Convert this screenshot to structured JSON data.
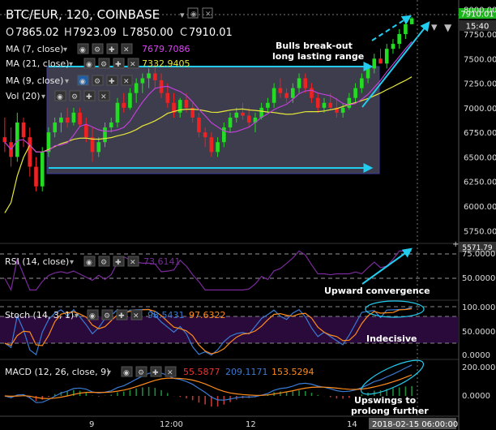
{
  "header": {
    "symbol": "BTC/EUR, 120, COINBASE",
    "ohlc": [
      {
        "k": "O",
        "v": "7865.02"
      },
      {
        "k": "H",
        "v": "7923.09"
      },
      {
        "k": "L",
        "v": "7850.00"
      },
      {
        "k": "C",
        "v": "7910.01"
      }
    ]
  },
  "indicators_main": [
    {
      "label": "MA (7, close)",
      "value": "7679.7086",
      "color": "#e040fb"
    },
    {
      "label": "MA (21, close)",
      "value": "7332.9405",
      "color": "#e8e83a"
    },
    {
      "label": "MA (9, close)",
      "value": "",
      "color": ""
    },
    {
      "label": "Vol (20)",
      "value": "",
      "color": ""
    }
  ],
  "price_badges": {
    "last": "7910.01",
    "time": "15:40"
  },
  "annotations": {
    "bulls": [
      "Bulls break-out",
      "long lasting range"
    ],
    "rsi": "Upward convergence",
    "stoch": "Indecisive",
    "macd": [
      "Upswings to",
      "prolong further"
    ]
  },
  "panes": {
    "rsi": {
      "label": "RSI (14, close)",
      "value": "73.6141",
      "ticks": [
        "75.0000",
        "50.0000"
      ]
    },
    "stoch": {
      "label": "Stoch (14, 3, 1)",
      "values": [
        "98.5431",
        "97.6322"
      ],
      "ticks": [
        "100.0000",
        "50.0000",
        "0.0000"
      ]
    },
    "macd": {
      "label": "MACD (12, 26, close, 9)",
      "values": [
        "55.5877",
        "209.1171",
        "153.5294"
      ],
      "ticks": [
        "200.0000",
        "0.0000"
      ]
    }
  },
  "x_axis": {
    "labels": [
      "9",
      "12:00",
      "12",
      "14"
    ],
    "current": "2018-02-15 06:00:00"
  },
  "colors": {
    "up": "#22dd22",
    "down": "#ee2222",
    "range_box": "#4a4a5e",
    "arrow": "#22ccee",
    "rsi": "#7a2a9a",
    "stoch_k": "#3a7bd5",
    "stoch_d": "#ff8c1a",
    "macd": "#3a7bd5",
    "signal": "#ff8c1a"
  },
  "chart_data": {
    "type": "candlestick",
    "y_ticks": [
      8000,
      7750,
      7500,
      7250,
      7000,
      6750,
      6500,
      6250,
      6000,
      5750
    ],
    "ylim": [
      5620,
      8080
    ],
    "candles": [
      [
        6700,
        6900,
        6550,
        6650
      ],
      [
        6650,
        6800,
        6400,
        6500
      ],
      [
        6500,
        6950,
        6450,
        6850
      ],
      [
        6850,
        6900,
        6600,
        6700
      ],
      [
        6700,
        6800,
        6300,
        6400
      ],
      [
        6400,
        6500,
        6150,
        6200
      ],
      [
        6200,
        6600,
        6150,
        6550
      ],
      [
        6550,
        6800,
        6500,
        6750
      ],
      [
        6750,
        6900,
        6700,
        6850
      ],
      [
        6850,
        6950,
        6750,
        6900
      ],
      [
        6900,
        7000,
        6800,
        6850
      ],
      [
        6850,
        7000,
        6820,
        6950
      ],
      [
        6950,
        7000,
        6800,
        6830
      ],
      [
        6830,
        6900,
        6650,
        6700
      ],
      [
        6700,
        6800,
        6450,
        6550
      ],
      [
        6550,
        6700,
        6500,
        6650
      ],
      [
        6650,
        6850,
        6600,
        6800
      ],
      [
        6800,
        6900,
        6750,
        6850
      ],
      [
        6850,
        7100,
        6800,
        7050
      ],
      [
        7050,
        7150,
        6950,
        7000
      ],
      [
        7000,
        7200,
        6980,
        7150
      ],
      [
        7150,
        7300,
        7050,
        7250
      ],
      [
        7250,
        7350,
        7150,
        7300
      ],
      [
        7300,
        7400,
        7200,
        7350
      ],
      [
        7350,
        7450,
        7200,
        7280
      ],
      [
        7280,
        7350,
        7100,
        7150
      ],
      [
        7150,
        7250,
        7000,
        7050
      ],
      [
        7050,
        7150,
        6900,
        6950
      ],
      [
        6950,
        7100,
        6900,
        7080
      ],
      [
        7080,
        7150,
        6950,
        7000
      ],
      [
        7000,
        7050,
        6850,
        6900
      ],
      [
        6900,
        6950,
        6700,
        6750
      ],
      [
        6750,
        6800,
        6600,
        6700
      ],
      [
        6700,
        6750,
        6500,
        6550
      ],
      [
        6550,
        6700,
        6500,
        6650
      ],
      [
        6650,
        6850,
        6600,
        6800
      ],
      [
        6800,
        6950,
        6750,
        6900
      ],
      [
        6900,
        7000,
        6850,
        6950
      ],
      [
        6950,
        7050,
        6880,
        6920
      ],
      [
        6920,
        7000,
        6800,
        6850
      ],
      [
        6850,
        6950,
        6750,
        6900
      ],
      [
        6900,
        7050,
        6880,
        7000
      ],
      [
        7000,
        7100,
        6950,
        7050
      ],
      [
        7050,
        7250,
        7000,
        7200
      ],
      [
        7200,
        7300,
        7100,
        7150
      ],
      [
        7150,
        7200,
        7050,
        7100
      ],
      [
        7100,
        7250,
        7050,
        7200
      ],
      [
        7200,
        7350,
        7150,
        7300
      ],
      [
        7300,
        7350,
        7150,
        7200
      ],
      [
        7200,
        7250,
        7050,
        7100
      ],
      [
        7100,
        7150,
        6950,
        7000
      ],
      [
        7000,
        7100,
        6950,
        7050
      ],
      [
        7050,
        7150,
        6980,
        7000
      ],
      [
        7000,
        7100,
        6900,
        6950
      ],
      [
        6950,
        7050,
        6900,
        7000
      ],
      [
        7000,
        7150,
        6980,
        7100
      ],
      [
        7100,
        7250,
        7050,
        7200
      ],
      [
        7200,
        7350,
        7150,
        7300
      ],
      [
        7300,
        7450,
        7250,
        7400
      ],
      [
        7400,
        7550,
        7350,
        7500
      ],
      [
        7500,
        7600,
        7450,
        7450
      ],
      [
        7450,
        7650,
        7400,
        7600
      ],
      [
        7600,
        7700,
        7550,
        7650
      ],
      [
        7650,
        7800,
        7600,
        7750
      ],
      [
        7750,
        7900,
        7700,
        7850
      ],
      [
        7850,
        7923,
        7850,
        7910
      ]
    ]
  }
}
